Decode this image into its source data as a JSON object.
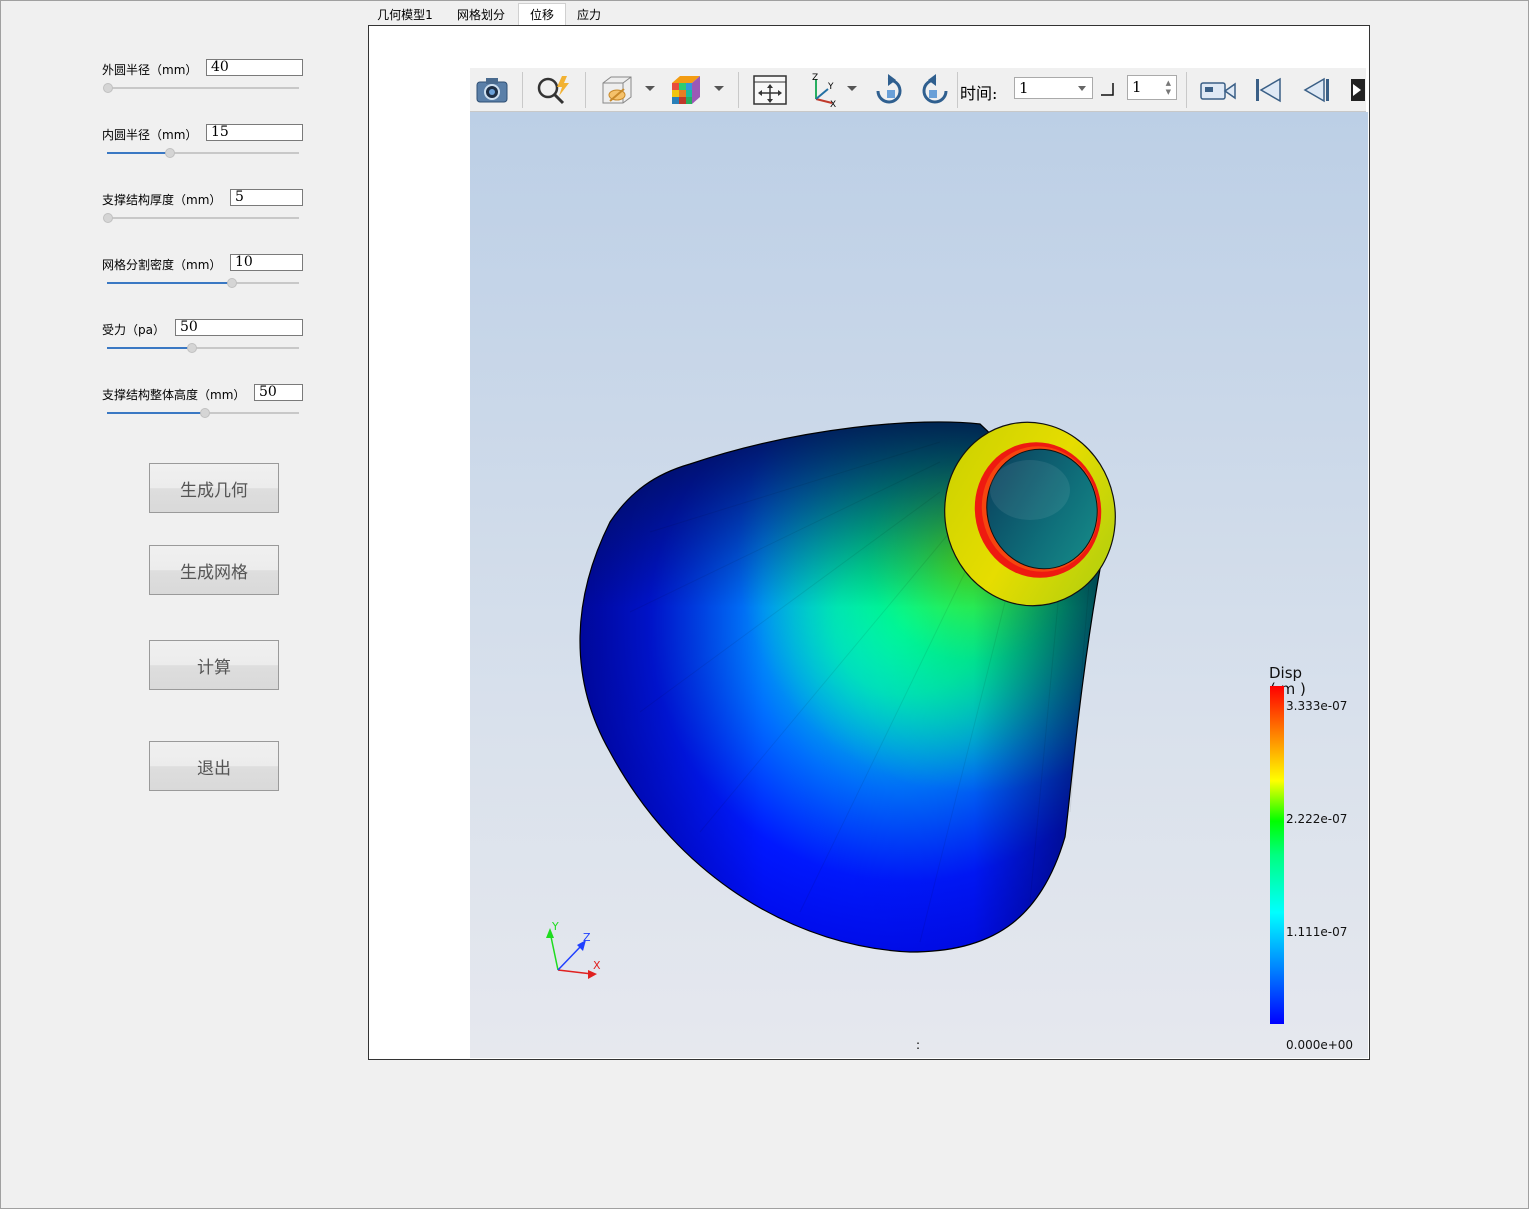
{
  "params": [
    {
      "label": "外圆半径（mm）",
      "value": "40",
      "slider": 0.0
    },
    {
      "label": "内圆半径（mm）",
      "value": "15",
      "slider": 0.33
    },
    {
      "label": "支撑结构厚度（mm）",
      "value": "5",
      "slider": 0.0
    },
    {
      "label": "网格分割密度（mm）",
      "value": "10",
      "slider": 0.65
    },
    {
      "label": "受力（pa）",
      "value": "50",
      "slider": 0.44
    },
    {
      "label": "支撑结构整体高度（mm）",
      "value": "50",
      "slider": 0.51
    }
  ],
  "buttons": {
    "gen_geometry": "生成几何",
    "gen_mesh": "生成网格",
    "compute": "计算",
    "exit": "退出"
  },
  "tabs": [
    "几何模型1",
    "网格划分",
    "位移",
    "应力"
  ],
  "active_tab": "位移",
  "toolbar": {
    "time_label": "时间:",
    "time_value": "1",
    "step_value": "1",
    "icons": [
      "camera-icon",
      "zoom-to-selection-icon",
      "render-view-icon",
      "color-cube-icon",
      "reset-camera-icon",
      "axes-orientation-icon",
      "rotate-plus-90-icon",
      "rotate-minus-90-icon",
      "record-icon",
      "first-frame-icon",
      "previous-frame-icon",
      "play-icon"
    ]
  },
  "legend": {
    "title": "Disp",
    "unit": "( m )",
    "max": "3.333e-07",
    "t2": "2.222e-07",
    "t1": "1.111e-07",
    "min": "0.000e+00"
  },
  "axes": {
    "x": "X",
    "y": "Y",
    "z": "Z"
  },
  "status_text": ":",
  "colors": {
    "colormap_low": "#0000ff",
    "colormap_high": "#ff0000",
    "tab_active_bg": "#ffffff",
    "background_top": "#bccfe6"
  }
}
